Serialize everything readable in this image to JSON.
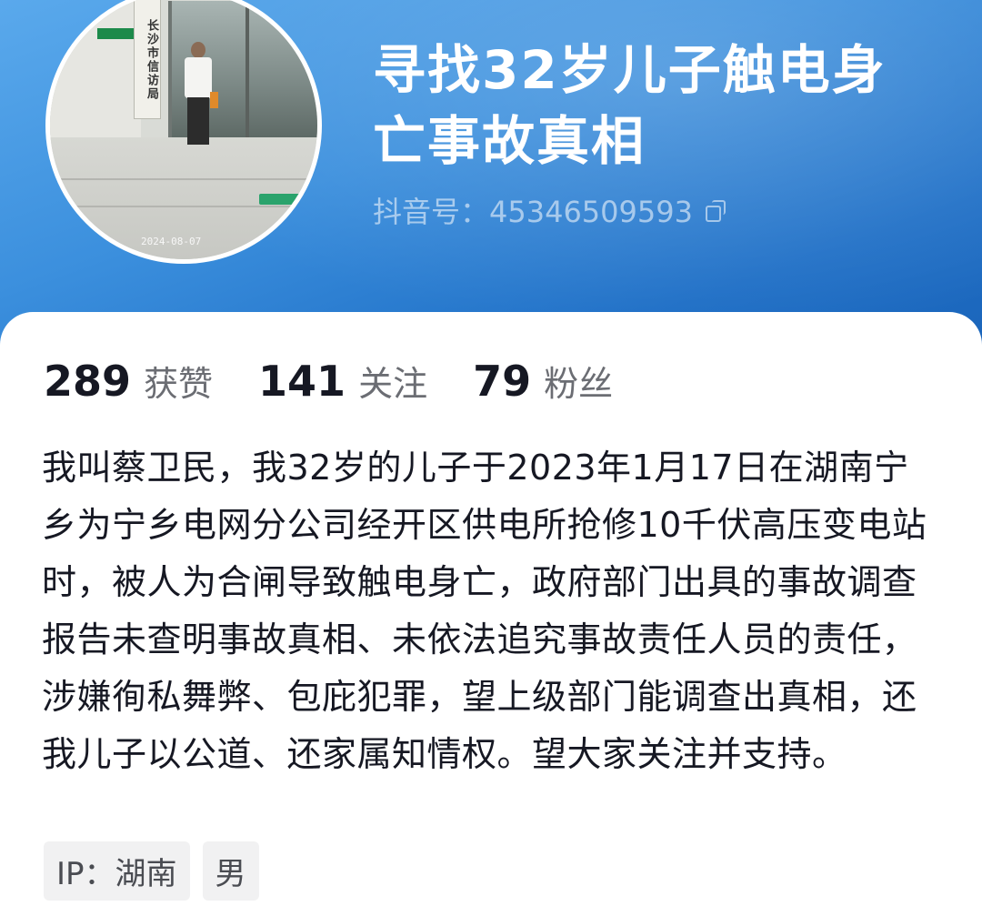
{
  "profile": {
    "title_line1": "寻找32岁儿子触电身",
    "title_line2": "亡事故真相",
    "douyin_id": "抖音号：45346509593"
  },
  "avatar": {
    "sign_text": "长沙市信访局",
    "date_stamp": "2024-08-07"
  },
  "stats": [
    {
      "value": "289",
      "label": "获赞"
    },
    {
      "value": "141",
      "label": "关注"
    },
    {
      "value": "79",
      "label": "粉丝"
    }
  ],
  "bio": "我叫蔡卫民，我32岁的儿子于2023年1月17日在湖南宁乡为宁乡电网分公司经开区供电所抢修10千伏高压变电站时，被人为合闸导致触电身亡，政府部门出具的事故调查报告未查明事故真相、未依法追究事故责任人员的责任，涉嫌徇私舞弊、包庇犯罪，望上级部门能调查出真相，还我儿子以公道、还家属知情权。望大家关注并支持。",
  "tags": {
    "ip": "IP：湖南",
    "gender": "男"
  },
  "colors": {
    "header_gradient_start": "#5aa9ec",
    "header_gradient_end": "#1a63b8",
    "text_primary": "#161823",
    "text_secondary": "#6b6d73"
  }
}
